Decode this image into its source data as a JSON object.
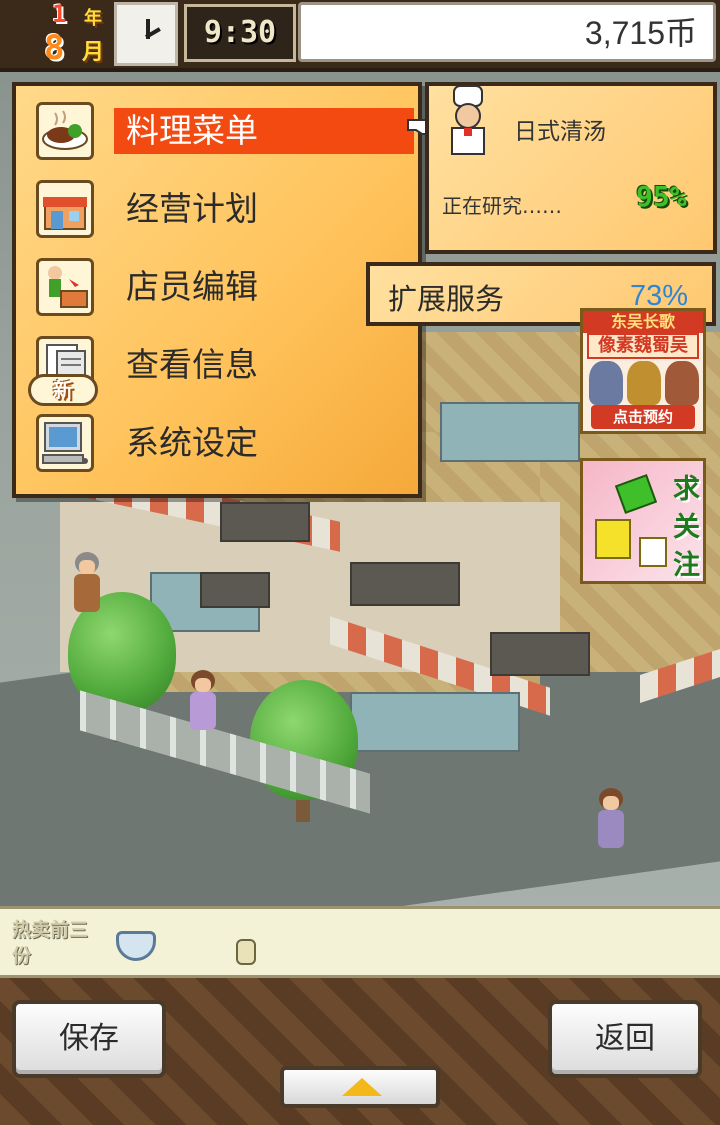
{
  "hud": {
    "year": "1",
    "year_unit": "年",
    "month": "8",
    "month_unit": "月",
    "time": "9:30",
    "money": "3,715币"
  },
  "menu": {
    "items": [
      {
        "label": "料理菜单",
        "icon": "dish-icon"
      },
      {
        "label": "经营计划",
        "icon": "shop-icon"
      },
      {
        "label": "店员编辑",
        "icon": "staff-icon"
      },
      {
        "label": "查看信息",
        "icon": "newspaper-icon"
      },
      {
        "label": "系统设定",
        "icon": "computer-icon"
      }
    ],
    "new_badge": "新"
  },
  "research": {
    "dish": "日式清汤",
    "status": "正在研究……",
    "progress": "95%"
  },
  "expand": {
    "label": "扩展服务",
    "progress": "73%"
  },
  "ads": {
    "ad1": {
      "top": "东吴长歌",
      "mid": "像素魏蜀吴",
      "button": "点击预约"
    },
    "ad2": {
      "chars": [
        "求",
        "关",
        "注"
      ]
    }
  },
  "bestseller": {
    "label": "热卖前三份"
  },
  "bottom": {
    "save": "保存",
    "back": "返回"
  },
  "colors": {
    "menu_active": "#f34a12",
    "research_progress": "#3fbf2a",
    "expand_progress": "#2f86d6"
  }
}
